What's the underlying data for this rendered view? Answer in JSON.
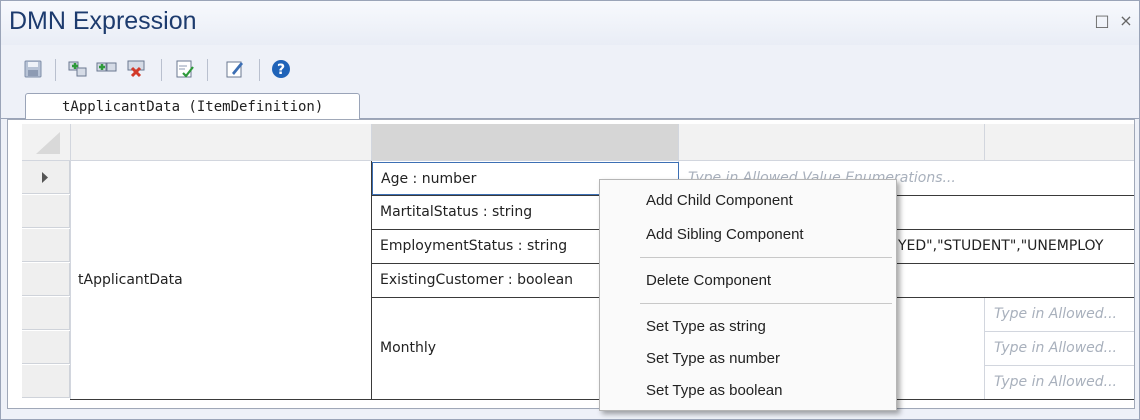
{
  "window": {
    "title": "DMN Expression",
    "maximize_glyph": "□",
    "close_glyph": "×"
  },
  "toolbar": {
    "buttons": [
      {
        "icon": "save-icon"
      },
      {
        "icon": "add-child-icon"
      },
      {
        "icon": "add-sibling-icon"
      },
      {
        "icon": "delete-icon"
      },
      {
        "icon": "validate-icon"
      },
      {
        "icon": "edit-icon"
      },
      {
        "icon": "help-icon"
      }
    ]
  },
  "tab": {
    "label": "tApplicantData (ItemDefinition)"
  },
  "grid": {
    "row_label": "tApplicantData",
    "components": [
      "Age : number",
      "MartitalStatus : string",
      "EmploymentStatus : string",
      "ExistingCustomer : boolean",
      "Monthly"
    ],
    "allowed_values_placeholder": "Type in Allowed Value Enumerations...",
    "employment_values_visible": "YED\",\"STUDENT\",\"UNEMPLOY",
    "nested_placeholder": "Type in Allowed..."
  },
  "context_menu": {
    "items": [
      "Add Child Component",
      "Add Sibling Component",
      "Delete Component",
      "Set Type as string",
      "Set Type as number",
      "Set Type as boolean"
    ]
  },
  "colors": {
    "title": "#1d3b6e",
    "selection_border": "#3c6fb4",
    "accent_green": "#2e9a3a",
    "accent_red": "#d23a2a",
    "help_blue": "#1f63b8"
  }
}
